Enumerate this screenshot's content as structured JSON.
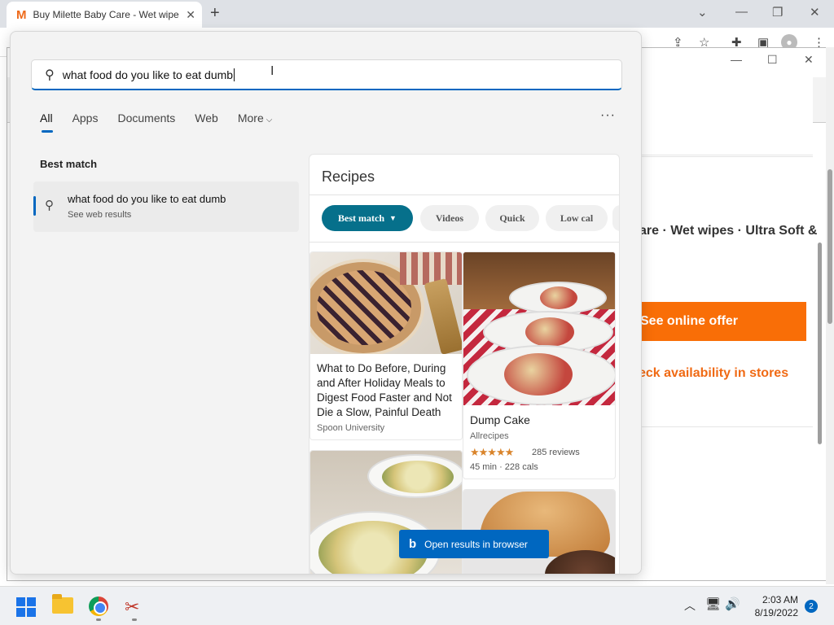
{
  "browser": {
    "tab_title": "Buy Milette Baby Care - Wet wipe",
    "tab_favicon": "M",
    "new_tab": "+",
    "close_tab": "✕",
    "win_min": "—",
    "win_restore": "❐",
    "win_close": "✕",
    "tab_search": "⌄"
  },
  "page": {
    "product_title": "are · Wet wipes · Ultra Soft &",
    "offer_button": "See online offer",
    "stores_link": "eck availability in stores"
  },
  "search": {
    "query": "what food do you like to eat dumb",
    "tabs": [
      "All",
      "Apps",
      "Documents",
      "Web",
      "More"
    ],
    "more_options": "···",
    "best_match_heading": "Best match",
    "best_match": {
      "title": "what food do you like to eat dumb",
      "subtitle": "See web results"
    },
    "recipes": {
      "heading": "Recipes",
      "filters": [
        "Best match",
        "Videos",
        "Quick",
        "Low cal"
      ],
      "cards": [
        {
          "title": "What to Do Before, During and After Holiday Meals to Digest Food Faster and Not Die a Slow, Painful Death",
          "source": "Spoon University"
        },
        {
          "title": "Dump Cake",
          "source": "Allrecipes",
          "rating": 4.5,
          "stars": "★★★★★",
          "reviews": "285 reviews",
          "time_cals": "45 min  ·  228 cals"
        }
      ]
    },
    "open_button": "Open results in browser"
  },
  "taskbar": {
    "time": "2:03 AM",
    "date": "8/19/2022",
    "notifications": "2"
  },
  "colors": {
    "accent": "#0067c0",
    "teal_pill": "#06708b",
    "offer_orange": "#f96e07"
  }
}
